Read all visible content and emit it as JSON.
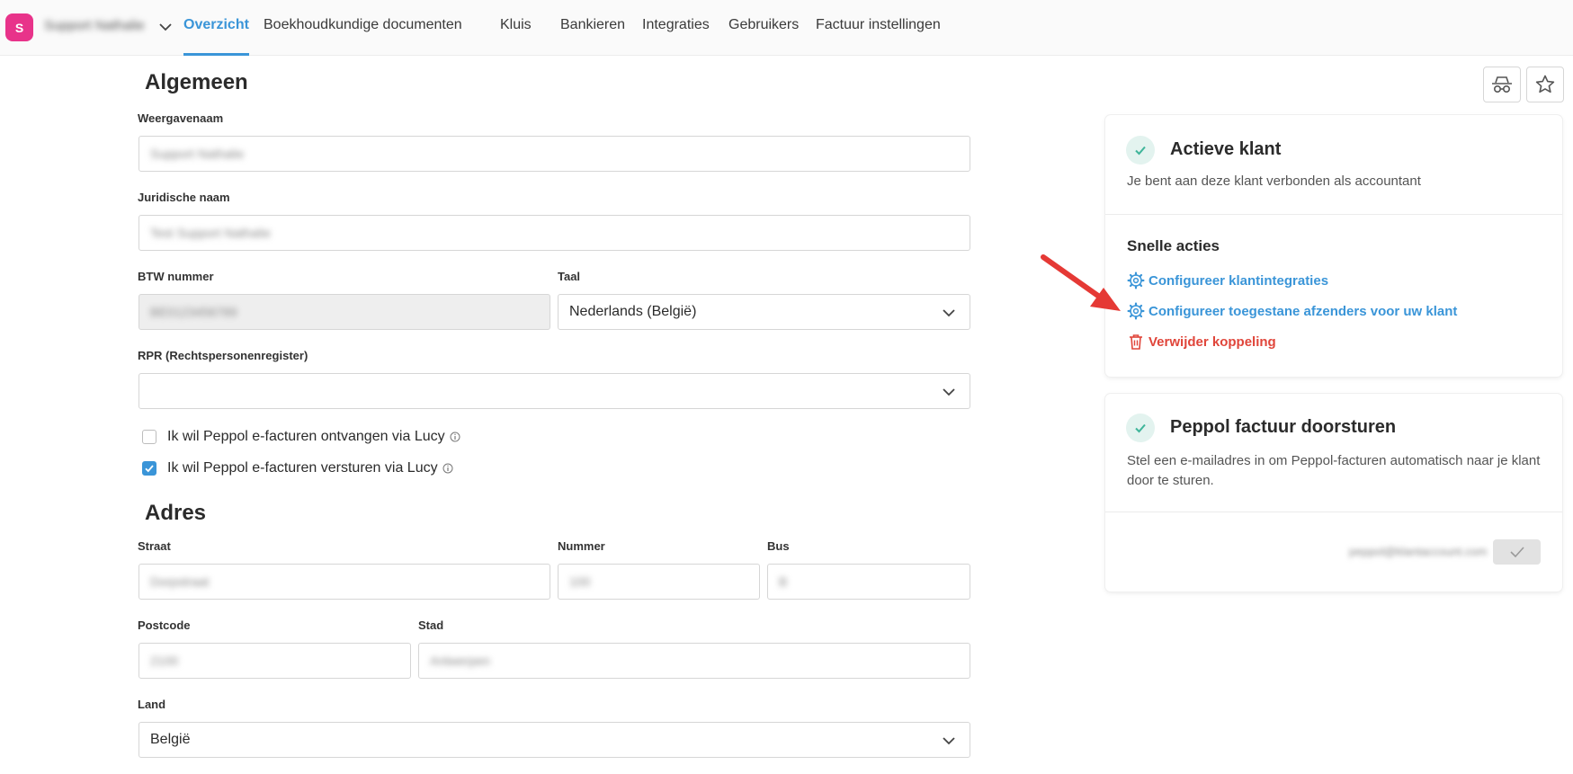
{
  "header": {
    "avatar_initial": "S",
    "org_name": "Support Nathalie",
    "tabs": [
      {
        "label": "Overzicht",
        "active": true
      },
      {
        "label": "Boekhoudkundige documenten"
      },
      {
        "label": "Kluis"
      },
      {
        "label": "Bankieren"
      },
      {
        "label": "Integraties"
      },
      {
        "label": "Gebruikers"
      },
      {
        "label": "Factuur instellingen"
      }
    ]
  },
  "general": {
    "title": "Algemeen",
    "display_name": {
      "label": "Weergavenaam",
      "value": "Support Nathalie"
    },
    "legal_name": {
      "label": "Juridische naam",
      "value": "Test Support Nathalie"
    },
    "vat_number": {
      "label": "BTW nummer",
      "value": "BE0123456789"
    },
    "language": {
      "label": "Taal",
      "value": "Nederlands (België)"
    },
    "rpr": {
      "label": "RPR (Rechtspersonenregister)",
      "value": ""
    },
    "peppol_receive": {
      "label": "Ik wil Peppol e-facturen ontvangen via Lucy",
      "checked": false
    },
    "peppol_send": {
      "label": "Ik wil Peppol e-facturen versturen via Lucy",
      "checked": true
    }
  },
  "address": {
    "title": "Adres",
    "street": {
      "label": "Straat",
      "value": "Dorpstraat"
    },
    "number": {
      "label": "Nummer",
      "value": "100"
    },
    "bus": {
      "label": "Bus",
      "value": "B"
    },
    "postcode": {
      "label": "Postcode",
      "value": "2100"
    },
    "city": {
      "label": "Stad",
      "value": "Antwerpen"
    },
    "country": {
      "label": "Land",
      "value": "België"
    }
  },
  "active_client_card": {
    "title": "Actieve klant",
    "description": "Je bent aan deze klant verbonden als accountant",
    "quick_actions_title": "Snelle acties",
    "actions": [
      {
        "label": "Configureer klantintegraties",
        "icon": "gear-icon"
      },
      {
        "label": "Configureer toegestane afzenders voor uw klant",
        "icon": "gear-icon"
      },
      {
        "label": "Verwijder koppeling",
        "icon": "trash-icon"
      }
    ]
  },
  "peppol_card": {
    "title": "Peppol factuur doorsturen",
    "description": "Stel een e-mailadres in om Peppol-facturen automatisch naar je klant door te sturen.",
    "email": "peppol@klantaccount.com"
  },
  "colors": {
    "accent": "#3a95d8",
    "danger": "#e0453a",
    "avatar": "#e8338a",
    "success": "#3fb59a",
    "arrow": "#e53935"
  }
}
